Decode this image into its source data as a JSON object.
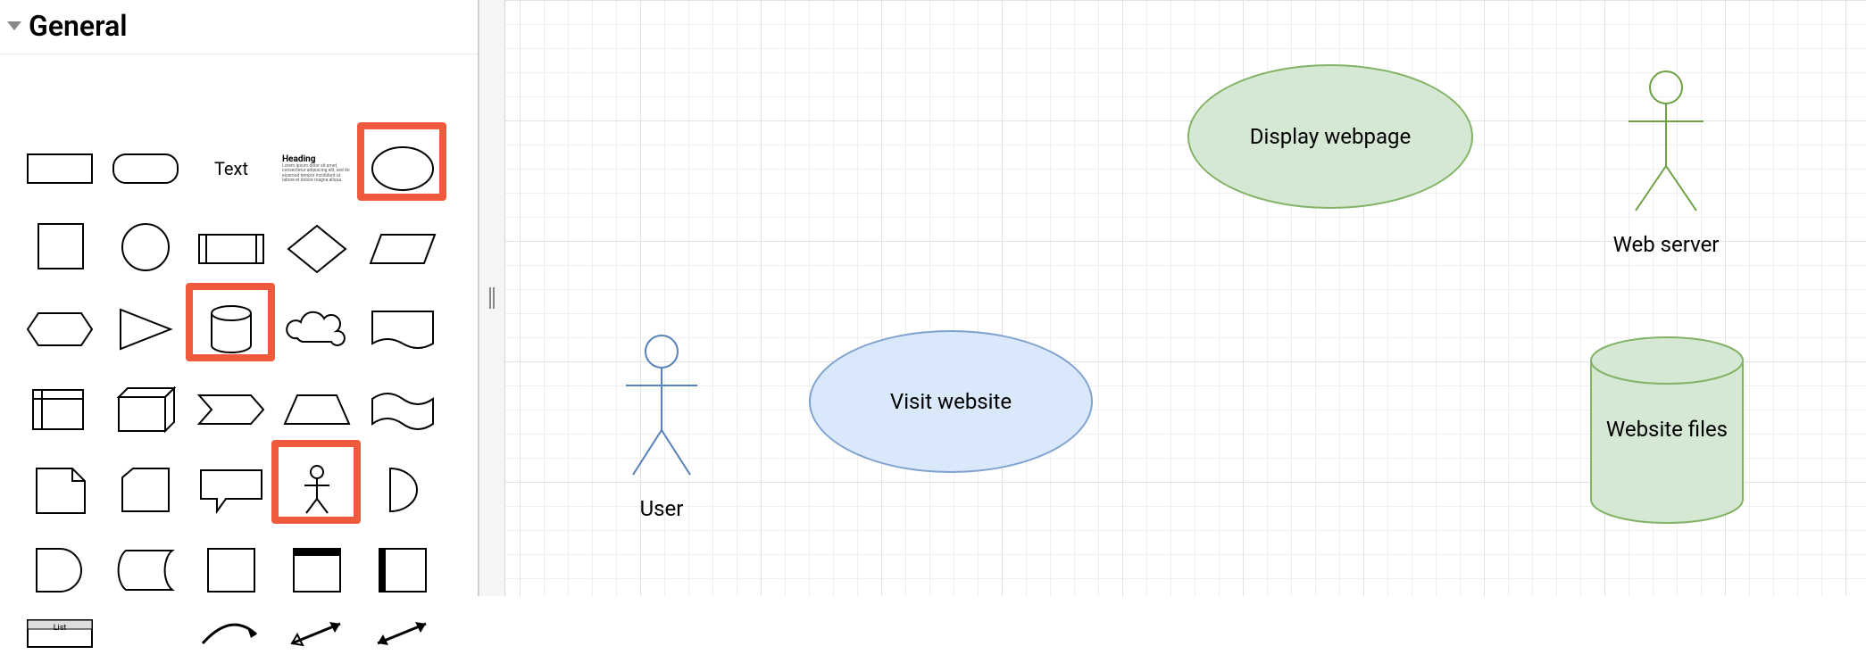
{
  "sidebar": {
    "section_title": "General",
    "shapes": {
      "text_label": "Text",
      "heading_label": "Heading",
      "list_label": "List"
    }
  },
  "canvas": {
    "nodes": {
      "user": {
        "label": "User",
        "stroke": "#5681b9",
        "fill": "none"
      },
      "visit_website": {
        "label": "Visit website",
        "stroke": "#7fa3ce",
        "fill": "#dae8fc"
      },
      "display_webpage": {
        "label": "Display webpage",
        "stroke": "#82b366",
        "fill": "#d5e8d4"
      },
      "web_server": {
        "label": "Web server",
        "stroke": "#6ea045",
        "fill": "none"
      },
      "website_files": {
        "label": "Website files",
        "stroke": "#82b366",
        "fill": "#d5e8d4"
      }
    }
  }
}
